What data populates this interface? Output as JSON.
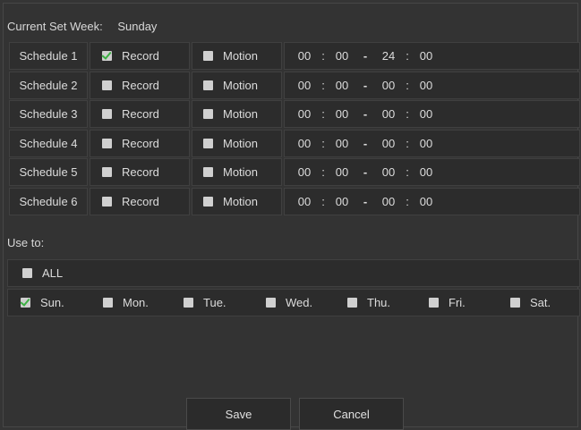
{
  "header": {
    "label": "Current Set Week:",
    "value": "Sunday"
  },
  "schedules": [
    {
      "name": "Schedule 1",
      "record_label": "Record",
      "record_checked": true,
      "motion_label": "Motion",
      "motion_checked": false,
      "start_h": "00",
      "start_m": "00",
      "end_h": "24",
      "end_m": "00"
    },
    {
      "name": "Schedule 2",
      "record_label": "Record",
      "record_checked": false,
      "motion_label": "Motion",
      "motion_checked": false,
      "start_h": "00",
      "start_m": "00",
      "end_h": "00",
      "end_m": "00"
    },
    {
      "name": "Schedule 3",
      "record_label": "Record",
      "record_checked": false,
      "motion_label": "Motion",
      "motion_checked": false,
      "start_h": "00",
      "start_m": "00",
      "end_h": "00",
      "end_m": "00"
    },
    {
      "name": "Schedule 4",
      "record_label": "Record",
      "record_checked": false,
      "motion_label": "Motion",
      "motion_checked": false,
      "start_h": "00",
      "start_m": "00",
      "end_h": "00",
      "end_m": "00"
    },
    {
      "name": "Schedule 5",
      "record_label": "Record",
      "record_checked": false,
      "motion_label": "Motion",
      "motion_checked": false,
      "start_h": "00",
      "start_m": "00",
      "end_h": "00",
      "end_m": "00"
    },
    {
      "name": "Schedule 6",
      "record_label": "Record",
      "record_checked": false,
      "motion_label": "Motion",
      "motion_checked": false,
      "start_h": "00",
      "start_m": "00",
      "end_h": "00",
      "end_m": "00"
    }
  ],
  "time_separator": ":",
  "range_separator": "-",
  "use_to": {
    "label": "Use to:",
    "all": {
      "label": "ALL",
      "checked": false
    },
    "days": [
      {
        "label": "Sun.",
        "checked": true
      },
      {
        "label": "Mon.",
        "checked": false
      },
      {
        "label": "Tue.",
        "checked": false
      },
      {
        "label": "Wed.",
        "checked": false
      },
      {
        "label": "Thu.",
        "checked": false
      },
      {
        "label": "Fri.",
        "checked": false
      },
      {
        "label": "Sat.",
        "checked": false
      }
    ]
  },
  "buttons": {
    "save": "Save",
    "cancel": "Cancel"
  },
  "colors": {
    "background": "#333333",
    "cell": "#2c2c2c",
    "check_mark": "#3cb043"
  }
}
